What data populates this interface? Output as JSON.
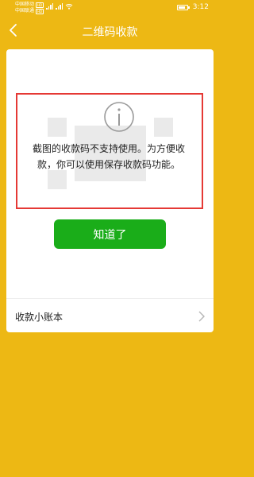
{
  "status_bar": {
    "carrier_1": "中国移动",
    "carrier_2": "中国联通",
    "hd_badge": "HD",
    "time": "3:12"
  },
  "nav": {
    "title": "二维码收款"
  },
  "notice": {
    "message": "截图的收款码不支持使用。为方便收款，你可以使用保存收款码功能。",
    "button_label": "知道了"
  },
  "ledger": {
    "label": "收款小账本"
  },
  "colors": {
    "background": "#EDB814",
    "button": "#1AAD19",
    "highlight_border": "#E53935"
  },
  "icons": [
    "back-arrow-icon",
    "info-icon",
    "chevron-right-icon",
    "signal-icon",
    "wifi-icon",
    "battery-icon"
  ]
}
